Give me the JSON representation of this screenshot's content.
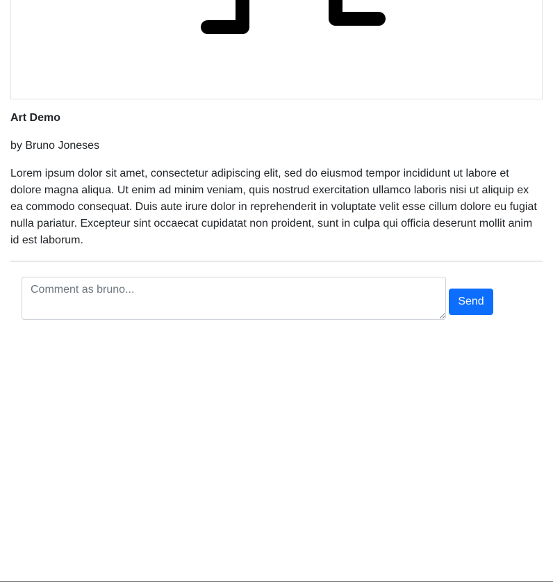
{
  "post": {
    "title": "Art Demo",
    "author_line": "by Bruno Joneses",
    "body": "Lorem ipsum dolor sit amet, consectetur adipiscing elit, sed do eiusmod tempor incididunt ut labore et dolore magna aliqua. Ut enim ad minim veniam, quis nostrud exercitation ullamco laboris nisi ut aliquip ex ea commodo consequat. Duis aute irure dolor in reprehenderit in voluptate velit esse cillum dolore eu fugiat nulla pariatur. Excepteur sint occaecat cupidatat non proident, sunt in culpa qui officia deserunt mollit anim id est laborum."
  },
  "comment": {
    "placeholder": "Comment as bruno...",
    "value": "",
    "send_label": "Send"
  },
  "colors": {
    "accent": "#0d6efd",
    "text": "#212529",
    "placeholder": "#6c757d",
    "border": "#ced4da",
    "artwork_stroke": "#000000"
  }
}
